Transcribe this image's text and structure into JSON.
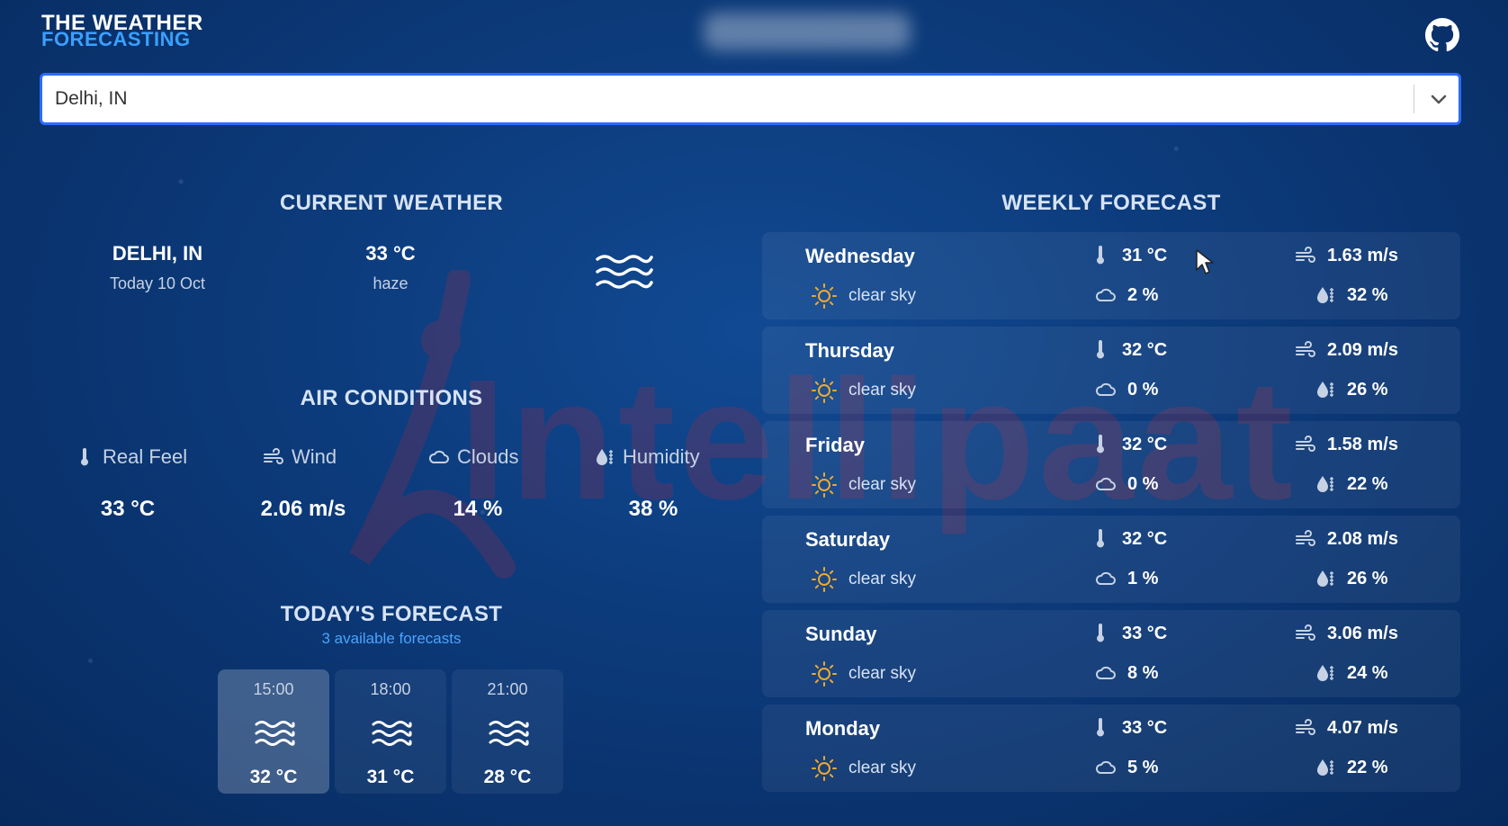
{
  "header": {
    "logo_line1": "THE WEATHER",
    "logo_line2": "FORECASTING"
  },
  "search": {
    "value": "Delhi, IN"
  },
  "current_weather": {
    "title": "CURRENT WEATHER",
    "city": "DELHI, IN",
    "date": "Today 10 Oct",
    "temperature": "33 °C",
    "description": "haze",
    "icon": "haze-icon"
  },
  "air_conditions": {
    "title": "AIR CONDITIONS",
    "real_feel_label": "Real Feel",
    "real_feel_value": "33 °C",
    "wind_label": "Wind",
    "wind_value": "2.06 m/s",
    "clouds_label": "Clouds",
    "clouds_value": "14 %",
    "humidity_label": "Humidity",
    "humidity_value": "38 %"
  },
  "todays_forecast": {
    "title": "TODAY'S FORECAST",
    "subtitle": "3 available forecasts",
    "items": [
      {
        "time": "15:00",
        "temp": "32 °C",
        "icon": "haze-icon"
      },
      {
        "time": "18:00",
        "temp": "31 °C",
        "icon": "haze-icon"
      },
      {
        "time": "21:00",
        "temp": "28 °C",
        "icon": "haze-icon"
      }
    ]
  },
  "weekly_forecast": {
    "title": "WEEKLY FORECAST",
    "days": [
      {
        "day": "Wednesday",
        "condition": "clear sky",
        "temp": "31 °C",
        "wind": "1.63 m/s",
        "clouds": "2 %",
        "humidity": "32 %"
      },
      {
        "day": "Thursday",
        "condition": "clear sky",
        "temp": "32 °C",
        "wind": "2.09 m/s",
        "clouds": "0 %",
        "humidity": "26 %"
      },
      {
        "day": "Friday",
        "condition": "clear sky",
        "temp": "32 °C",
        "wind": "1.58 m/s",
        "clouds": "0 %",
        "humidity": "22 %"
      },
      {
        "day": "Saturday",
        "condition": "clear sky",
        "temp": "32 °C",
        "wind": "2.08 m/s",
        "clouds": "1 %",
        "humidity": "26 %"
      },
      {
        "day": "Sunday",
        "condition": "clear sky",
        "temp": "33 °C",
        "wind": "3.06 m/s",
        "clouds": "8 %",
        "humidity": "24 %"
      },
      {
        "day": "Monday",
        "condition": "clear sky",
        "temp": "33 °C",
        "wind": "4.07 m/s",
        "clouds": "5 %",
        "humidity": "22 %"
      }
    ]
  },
  "watermark_text": "Intellipaat",
  "colors": {
    "accent": "#2c6bff",
    "logo_blue": "#3aa0ff",
    "sun_icon": "#f0a92a"
  }
}
